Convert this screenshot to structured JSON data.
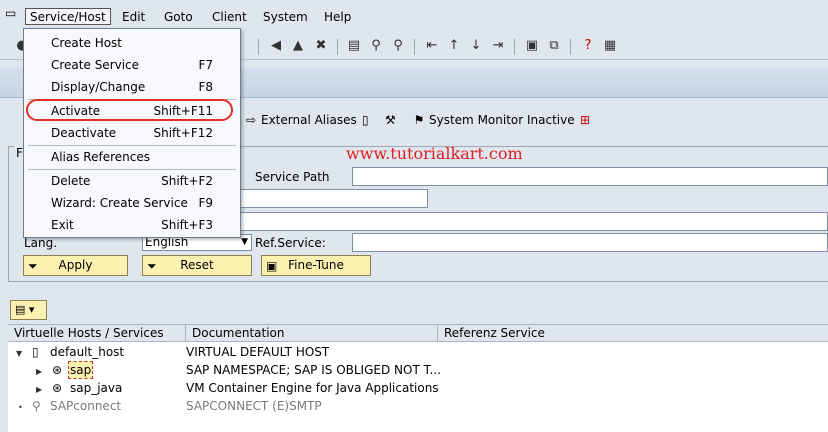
{
  "menubar": {
    "items": [
      "Service/Host",
      "Edit",
      "Goto",
      "Client",
      "System",
      "Help"
    ]
  },
  "dropdown": {
    "items": [
      {
        "label": "Create Host",
        "shortcut": ""
      },
      {
        "label": "Create Service",
        "shortcut": "F7"
      },
      {
        "label": "Display/Change",
        "shortcut": "F8"
      },
      {
        "label": "Activate",
        "shortcut": "Shift+F11"
      },
      {
        "label": "Deactivate",
        "shortcut": "Shift+F12"
      },
      {
        "label": "Alias References",
        "shortcut": ""
      },
      {
        "label": "Delete",
        "shortcut": "Shift+F2"
      },
      {
        "label": "Wizard: Create Service",
        "shortcut": "F9"
      },
      {
        "label": "Exit",
        "shortcut": "Shift+F3"
      }
    ]
  },
  "apptoolbar": {
    "external_aliases": "External Aliases",
    "system_monitor": "System Monitor Inactive"
  },
  "watermark": "www.tutorialkart.com",
  "filter": {
    "frame_title": "F",
    "service_path_label": "Service Path",
    "service_path_value": "",
    "lang_label": "Lang.",
    "lang_value": "English",
    "ref_service_label": "Ref.Service:",
    "ref_service_value": "",
    "apply_label": "Apply",
    "reset_label": "Reset",
    "finetune_label": "Fine-Tune"
  },
  "tree": {
    "columns": [
      "Virtuelle Hosts / Services",
      "Documentation",
      "Referenz Service"
    ],
    "rows": [
      {
        "name": "default_host",
        "doc": "VIRTUAL DEFAULT HOST",
        "ref": ""
      },
      {
        "name": "sap",
        "doc": "SAP NAMESPACE; SAP IS OBLIGED NOT T...",
        "ref": ""
      },
      {
        "name": "sap_java",
        "doc": "VM Container Engine for Java Applications",
        "ref": ""
      },
      {
        "name": "SAPconnect",
        "doc": "SAPCONNECT (E)SMTP",
        "ref": ""
      }
    ]
  },
  "colors": {
    "background": "#dfe6ee",
    "button_yellow": "#fdf1b2",
    "highlight_red": "#e0302a",
    "watermark_red": "#e02020"
  },
  "icons": {
    "system": "system-menu-icon",
    "enter": "enter-icon",
    "back": "back-icon",
    "exit": "exit-icon",
    "cancel": "cancel-icon",
    "print": "print-icon",
    "find": "find-icon",
    "find_next": "find-next-icon",
    "first_page": "first-page-icon",
    "prev_page": "prev-page-icon",
    "next_page": "next-page-icon",
    "last_page": "last-page-icon",
    "new_session": "new-session-icon",
    "shortcut": "shortcut-icon",
    "help": "help-icon",
    "layout": "layout-icon"
  }
}
